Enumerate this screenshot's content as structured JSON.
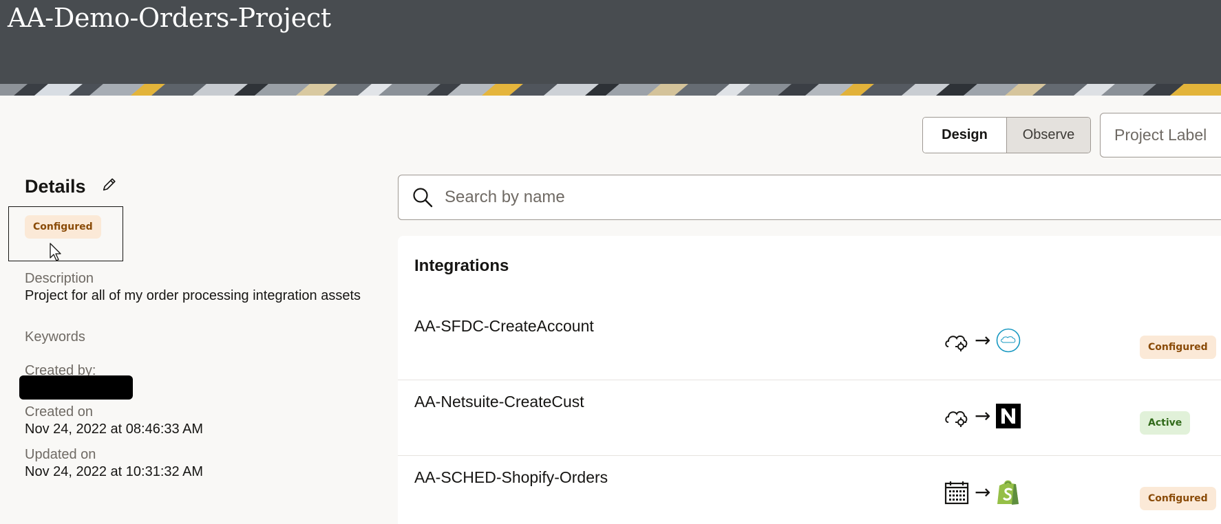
{
  "header": {
    "title": "AA-Demo-Orders-Project"
  },
  "view_toggle": {
    "design_label": "Design",
    "observe_label": "Observe"
  },
  "project_label": {
    "placeholder": "Project Label"
  },
  "details": {
    "heading": "Details",
    "status_badge": "Configured",
    "description_label": "Description",
    "description_value": "Project for all of my order processing integration assets",
    "keywords_label": "Keywords",
    "created_by_label": "Created by:",
    "created_on_label": "Created on",
    "created_on_value": "Nov 24, 2022 at 08:46:33 AM",
    "updated_on_label": "Updated on",
    "updated_on_value": "Nov 24, 2022 at 10:31:32 AM"
  },
  "search": {
    "placeholder": "Search by name"
  },
  "integrations": {
    "heading": "Integrations",
    "arrow": "→",
    "items": [
      {
        "name": "AA-SFDC-CreateAccount",
        "trigger_icon": "cloud-gear-icon",
        "target_icon": "salesforce-icon",
        "status": "Configured"
      },
      {
        "name": "AA-Netsuite-CreateCust",
        "trigger_icon": "cloud-gear-icon",
        "target_icon": "netsuite-icon",
        "status": "Active"
      },
      {
        "name": "AA-SCHED-Shopify-Orders",
        "trigger_icon": "calendar-icon",
        "target_icon": "shopify-icon",
        "status": "Configured"
      }
    ]
  },
  "colors": {
    "header_bg": "#484c50",
    "page_bg": "#f9f8f6",
    "configured_badge_bg": "#fbe9d7",
    "configured_badge_text": "#8a4b08",
    "active_badge_bg": "#e1f1d9",
    "active_badge_text": "#316a1a"
  }
}
